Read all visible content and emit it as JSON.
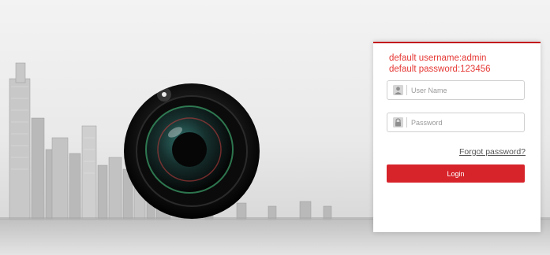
{
  "login_panel": {
    "notice_line1": "default username:admin",
    "notice_line2": "default password:123456",
    "username_placeholder": "User Name",
    "password_placeholder": "Password",
    "forgot_link": "Forgot password?",
    "login_button": "Login"
  },
  "icons": {
    "username": "user-icon",
    "password": "lock-icon",
    "hero": "camera-lens-illustration",
    "background": "city-skyline"
  },
  "colors": {
    "accent": "#d7232a",
    "notice_text": "#e53935",
    "panel_border": "#c4161c"
  }
}
